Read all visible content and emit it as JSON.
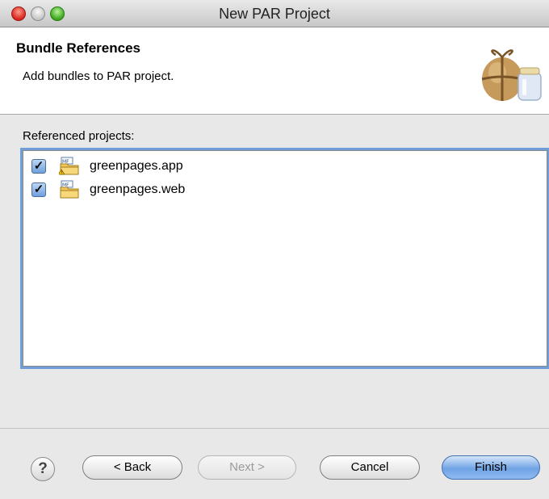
{
  "window": {
    "title": "New PAR Project",
    "controls": [
      "close-button",
      "minimize-button",
      "zoom-button"
    ]
  },
  "header": {
    "title": "Bundle References",
    "description": "Add bundles to PAR project.",
    "image_icon": "jar-package-icon"
  },
  "section": {
    "label": "Referenced projects:"
  },
  "projects": [
    {
      "label": "greenpages.app",
      "checked": true,
      "icon": "bundle-project-warning-icon"
    },
    {
      "label": "greenpages.web",
      "checked": true,
      "icon": "bundle-project-icon"
    }
  ],
  "buttons": {
    "help": "?",
    "back": "< Back",
    "next": "Next >",
    "cancel": "Cancel",
    "finish": "Finish"
  },
  "state": {
    "next_enabled": false,
    "default_button": "finish"
  },
  "colors": {
    "selection_focus": "#6e9fd9",
    "default_button": "#6fa3e6",
    "close": "#d8231c",
    "zoom": "#39a51a"
  }
}
